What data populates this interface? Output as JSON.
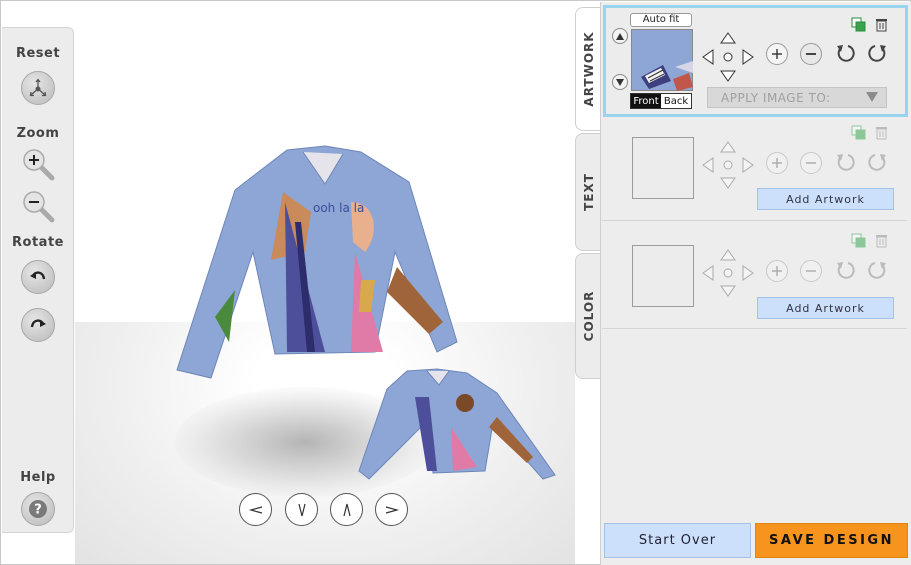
{
  "toolbar": {
    "reset_label": "Reset",
    "zoom_label": "Zoom",
    "rotate_label": "Rotate",
    "help_label": "Help"
  },
  "tabs": [
    {
      "label": "ARTWORK",
      "active": true
    },
    {
      "label": "TEXT",
      "active": false
    },
    {
      "label": "COLOR",
      "active": false
    }
  ],
  "artwork_slots": [
    {
      "active": true,
      "autofit_label": "Auto fit",
      "side_options": [
        "Front",
        "Back"
      ],
      "selected_side": "Front",
      "apply_placeholder": "APPLY IMAGE TO:"
    },
    {
      "active": false,
      "add_label": "Add Artwork"
    },
    {
      "active": false,
      "add_label": "Add Artwork"
    }
  ],
  "footer": {
    "start_over_label": "Start Over",
    "save_label": "SAVE DESIGN"
  },
  "colors": {
    "accent_orange": "#f7941d",
    "button_blue": "#cde0fb",
    "active_outline": "#9ad3ef",
    "shirt_blue": "#8ea6d6"
  }
}
